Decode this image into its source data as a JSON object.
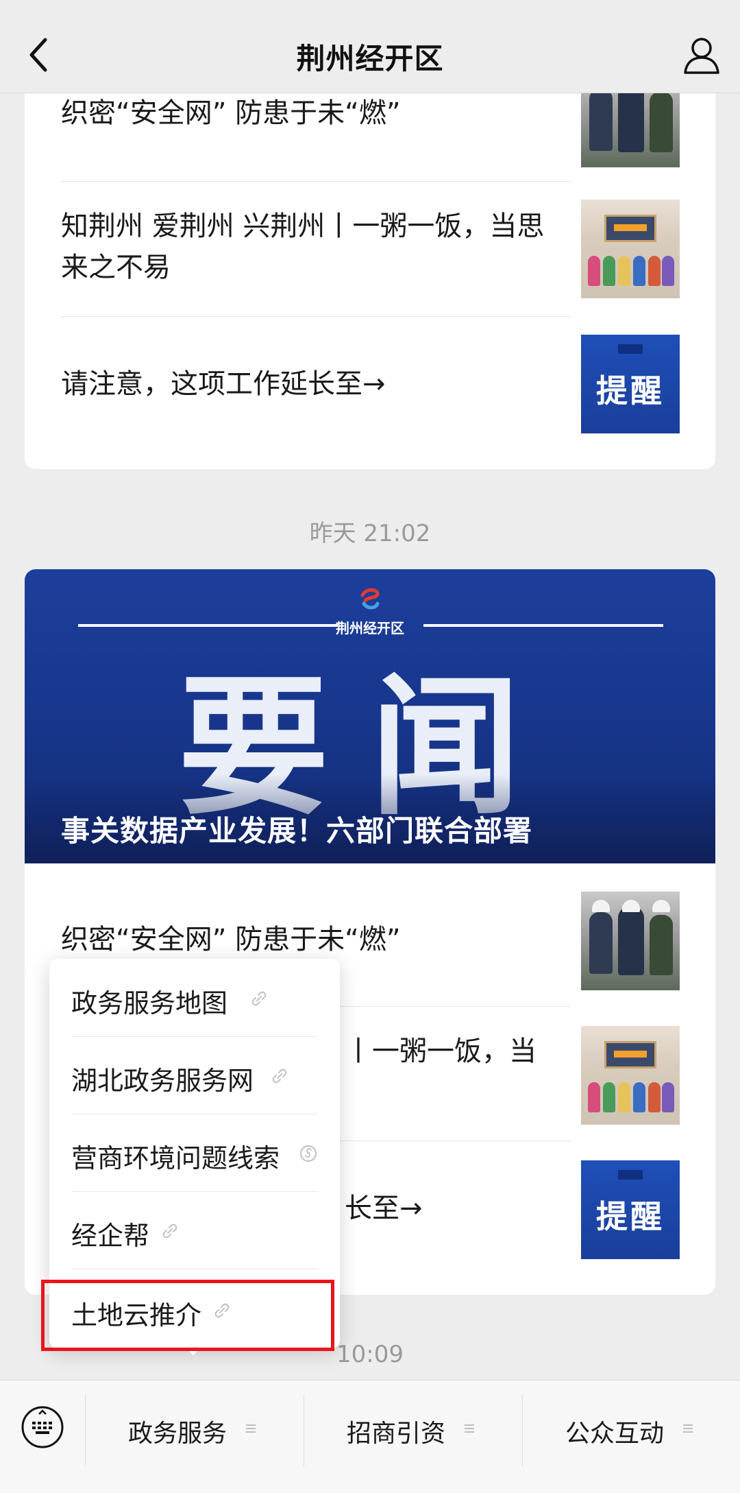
{
  "nav": {
    "title": "荆州经开区",
    "back_icon": "chevron-left-icon",
    "profile_icon": "user-icon"
  },
  "card1": {
    "articles": [
      {
        "title": "织密“安全网” 防患于未“燃”"
      },
      {
        "title": "知荆州 爱荆州 兴荆州丨一粥一饭，当思来之不易"
      },
      {
        "title": "请注意，这项工作延长至→",
        "thumb_text": "提醒"
      }
    ]
  },
  "time_separators": [
    "昨天 21:02",
    "10:09"
  ],
  "card2": {
    "banner": {
      "org": "荆州经开区",
      "big_text": "要闻",
      "caption": "事关数据产业发展！六部门联合部署"
    },
    "articles": [
      {
        "title": "织密“安全网” 防患于未“燃”"
      },
      {
        "title_visible": "丨一粥一饭，当"
      },
      {
        "title_visible": "长至→",
        "thumb_text": "提醒"
      }
    ]
  },
  "popup_menu": {
    "items": [
      {
        "label": "政务服务地图"
      },
      {
        "label": "湖北政务服务网"
      },
      {
        "label": "营商环境问题线索"
      },
      {
        "label": "经企帮"
      },
      {
        "label": "土地云推介"
      }
    ],
    "highlighted": "土地云推介",
    "highlight_color": "#e8151b"
  },
  "bottom_bar": {
    "keyboard_icon": "keyboard-icon",
    "menus": [
      {
        "label": "政务服务"
      },
      {
        "label": "招商引资"
      },
      {
        "label": "公众互动"
      }
    ]
  },
  "colors": {
    "background": "#ededed",
    "banner_blue": "#1d3f9c",
    "timestamp": "#9a9a9a"
  }
}
